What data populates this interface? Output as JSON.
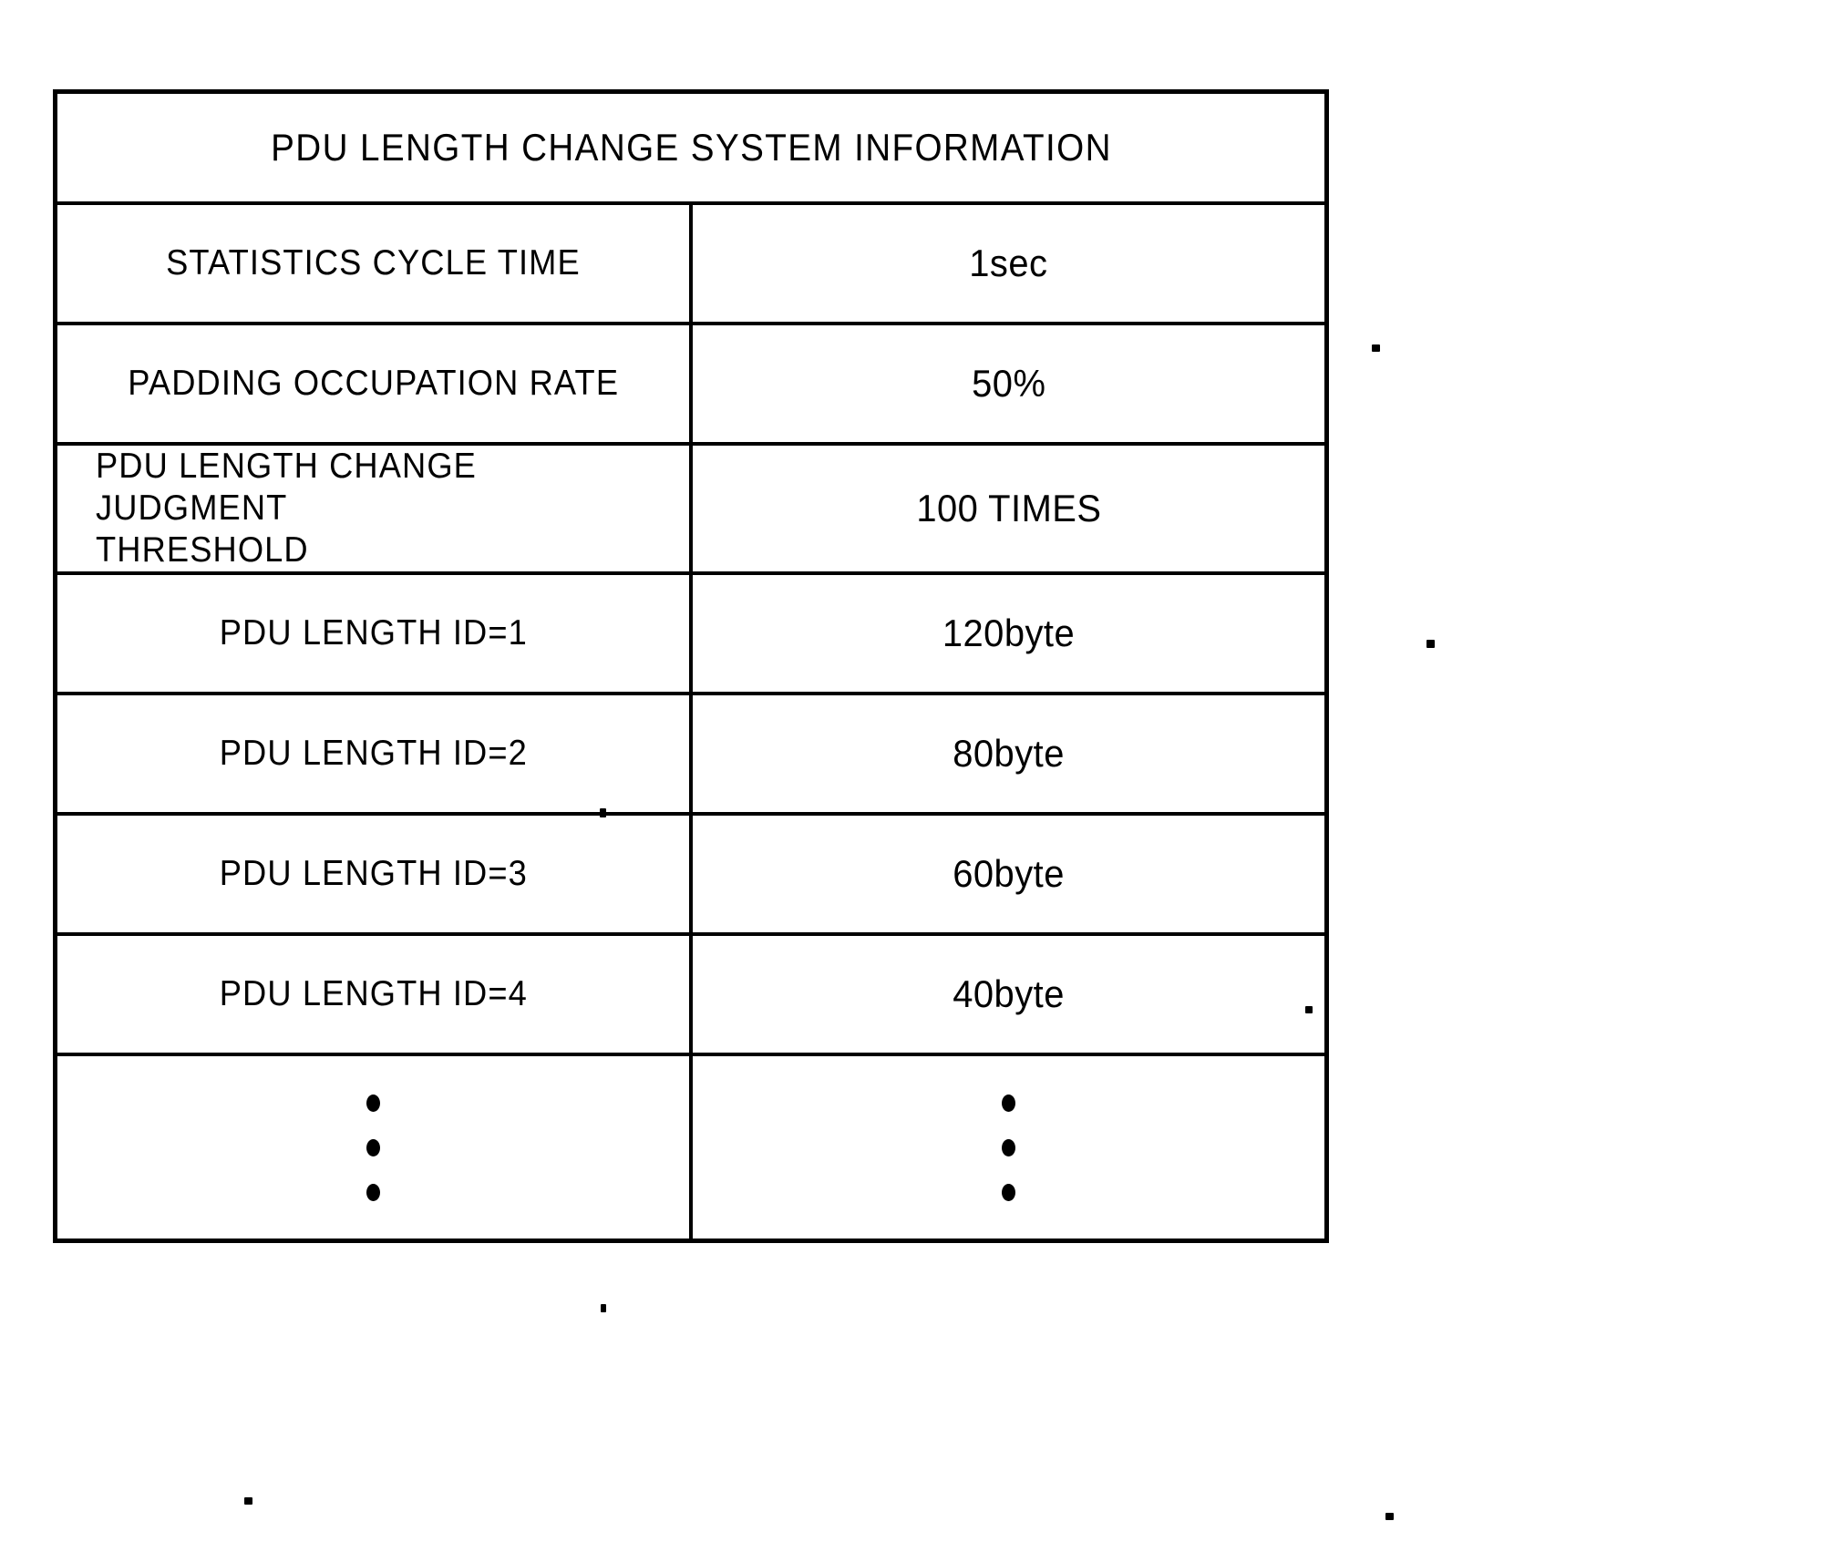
{
  "figure": {
    "title": "PDU LENGTH CHANGE SYSTEM INFORMATION",
    "columns": [
      "",
      ""
    ],
    "rows": [
      {
        "label": "STATISTICS CYCLE TIME",
        "label_line2": "",
        "value": "1sec"
      },
      {
        "label": "PADDING OCCUPATION RATE",
        "label_line2": "",
        "value": "50%"
      },
      {
        "label": "PDU LENGTH CHANGE JUDGMENT",
        "label_line2": "THRESHOLD",
        "value": "100 TIMES"
      },
      {
        "label": "PDU LENGTH ID=1",
        "label_line2": "",
        "value": "120byte"
      },
      {
        "label": "PDU LENGTH ID=2",
        "label_line2": "",
        "value": "80byte"
      },
      {
        "label": "PDU LENGTH ID=3",
        "label_line2": "",
        "value": "60byte"
      },
      {
        "label": "PDU LENGTH ID=4",
        "label_line2": "",
        "value": "40byte"
      }
    ],
    "continuation": {
      "label_ellipsis": "vertical-ellipsis",
      "value_ellipsis": "vertical-ellipsis",
      "dot_count": 3
    },
    "colors": {
      "ink": "#000000",
      "paper": "#ffffff"
    }
  }
}
